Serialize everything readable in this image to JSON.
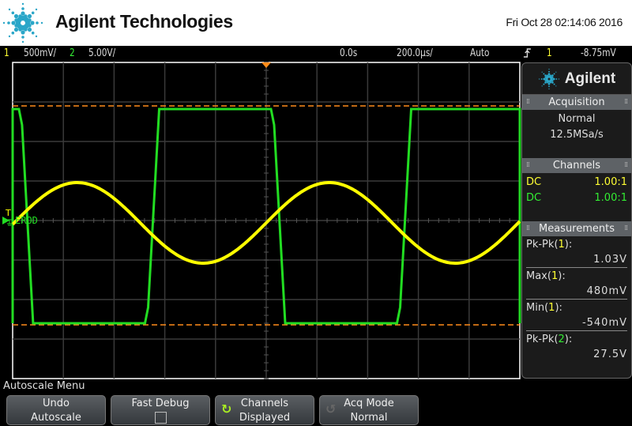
{
  "header": {
    "brand": "Agilent Technologies",
    "datetime": "Fri Oct 28 02:14:06 2016",
    "accent_color": "#2aa6c8"
  },
  "statusbar": {
    "ch1_label": "1",
    "ch1_scale": "500mV/",
    "ch2_label": "2",
    "ch2_scale": "5.00V/",
    "time_delay": "0.0s",
    "time_scale": "200.0µs/",
    "trigger_mode": "Auto",
    "trigger_slope_icon": "rising-edge-icon",
    "trigger_source": "1",
    "trigger_level": "-8.75mV"
  },
  "scope": {
    "ch1_color": "#ffff00",
    "ch2_color": "#22dd22",
    "ground_marker_label": "T",
    "ch2_label_text": "EROD",
    "ch1": {
      "type": "sine",
      "volts_per_div": 0.5,
      "max_v": 0.48,
      "min_v": -0.54,
      "period_div": 4.97,
      "phase": "rising-zero-at-center"
    },
    "ch2": {
      "type": "square",
      "volts_per_div": 5.0,
      "high_div": 2.82,
      "low_div": -2.6,
      "period_div": 4.97
    },
    "cursor_lines": {
      "color": "#ff8c1a",
      "upper_div": 2.9,
      "lower_div": -2.64
    },
    "divisions": {
      "horizontal": 10,
      "vertical": 8
    }
  },
  "panel": {
    "logo_text": "Agilent",
    "acquisition": {
      "title": "Acquisition",
      "mode": "Normal",
      "rate": "12.5MSa/s"
    },
    "channels": {
      "title": "Channels",
      "rows": [
        {
          "coupling": "DC",
          "probe": "1.00:1",
          "channel": 1
        },
        {
          "coupling": "DC",
          "probe": "1.00:1",
          "channel": 2
        }
      ]
    },
    "measurements": {
      "title": "Measurements",
      "items": [
        {
          "name": "Pk-Pk",
          "channel": "1",
          "value": "1.03V"
        },
        {
          "name": "Max",
          "channel": "1",
          "value": "480mV"
        },
        {
          "name": "Min",
          "channel": "1",
          "value": "-540mV"
        },
        {
          "name": "Pk-Pk",
          "channel": "2",
          "value": "27.5V"
        }
      ]
    }
  },
  "softkeys": {
    "menu_title": "Autoscale Menu",
    "keys": [
      {
        "line1": "Undo",
        "line2": "Autoscale"
      },
      {
        "line1": "Fast Debug",
        "line2": ""
      },
      {
        "line1": "Channels",
        "line2": "Displayed",
        "icon": "cycle-arrow-icon"
      },
      {
        "line1": "Acq Mode",
        "line2": "Normal",
        "icon": "cycle-arrow-icon"
      }
    ]
  }
}
